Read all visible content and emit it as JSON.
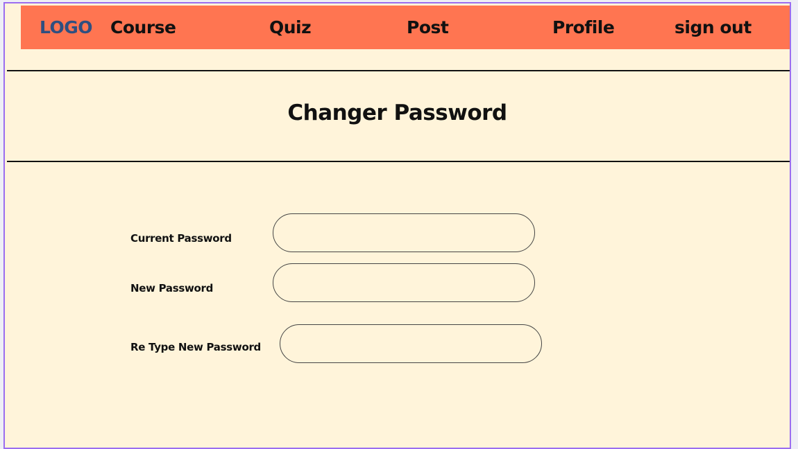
{
  "nav": {
    "logo": "LOGO",
    "items": [
      "Course",
      "Quiz",
      "Post",
      "Profile",
      "sign out"
    ]
  },
  "page": {
    "title": "Changer Password"
  },
  "form": {
    "current_password_label": "Current Password",
    "new_password_label": "New Password",
    "retype_password_label": "Re Type New Password",
    "current_password_value": "",
    "new_password_value": "",
    "retype_password_value": ""
  },
  "colors": {
    "nav_background": "#ff7551",
    "page_background": "#fff4da",
    "logo": "#2f4f80",
    "frame_border": "#9b6df0"
  }
}
